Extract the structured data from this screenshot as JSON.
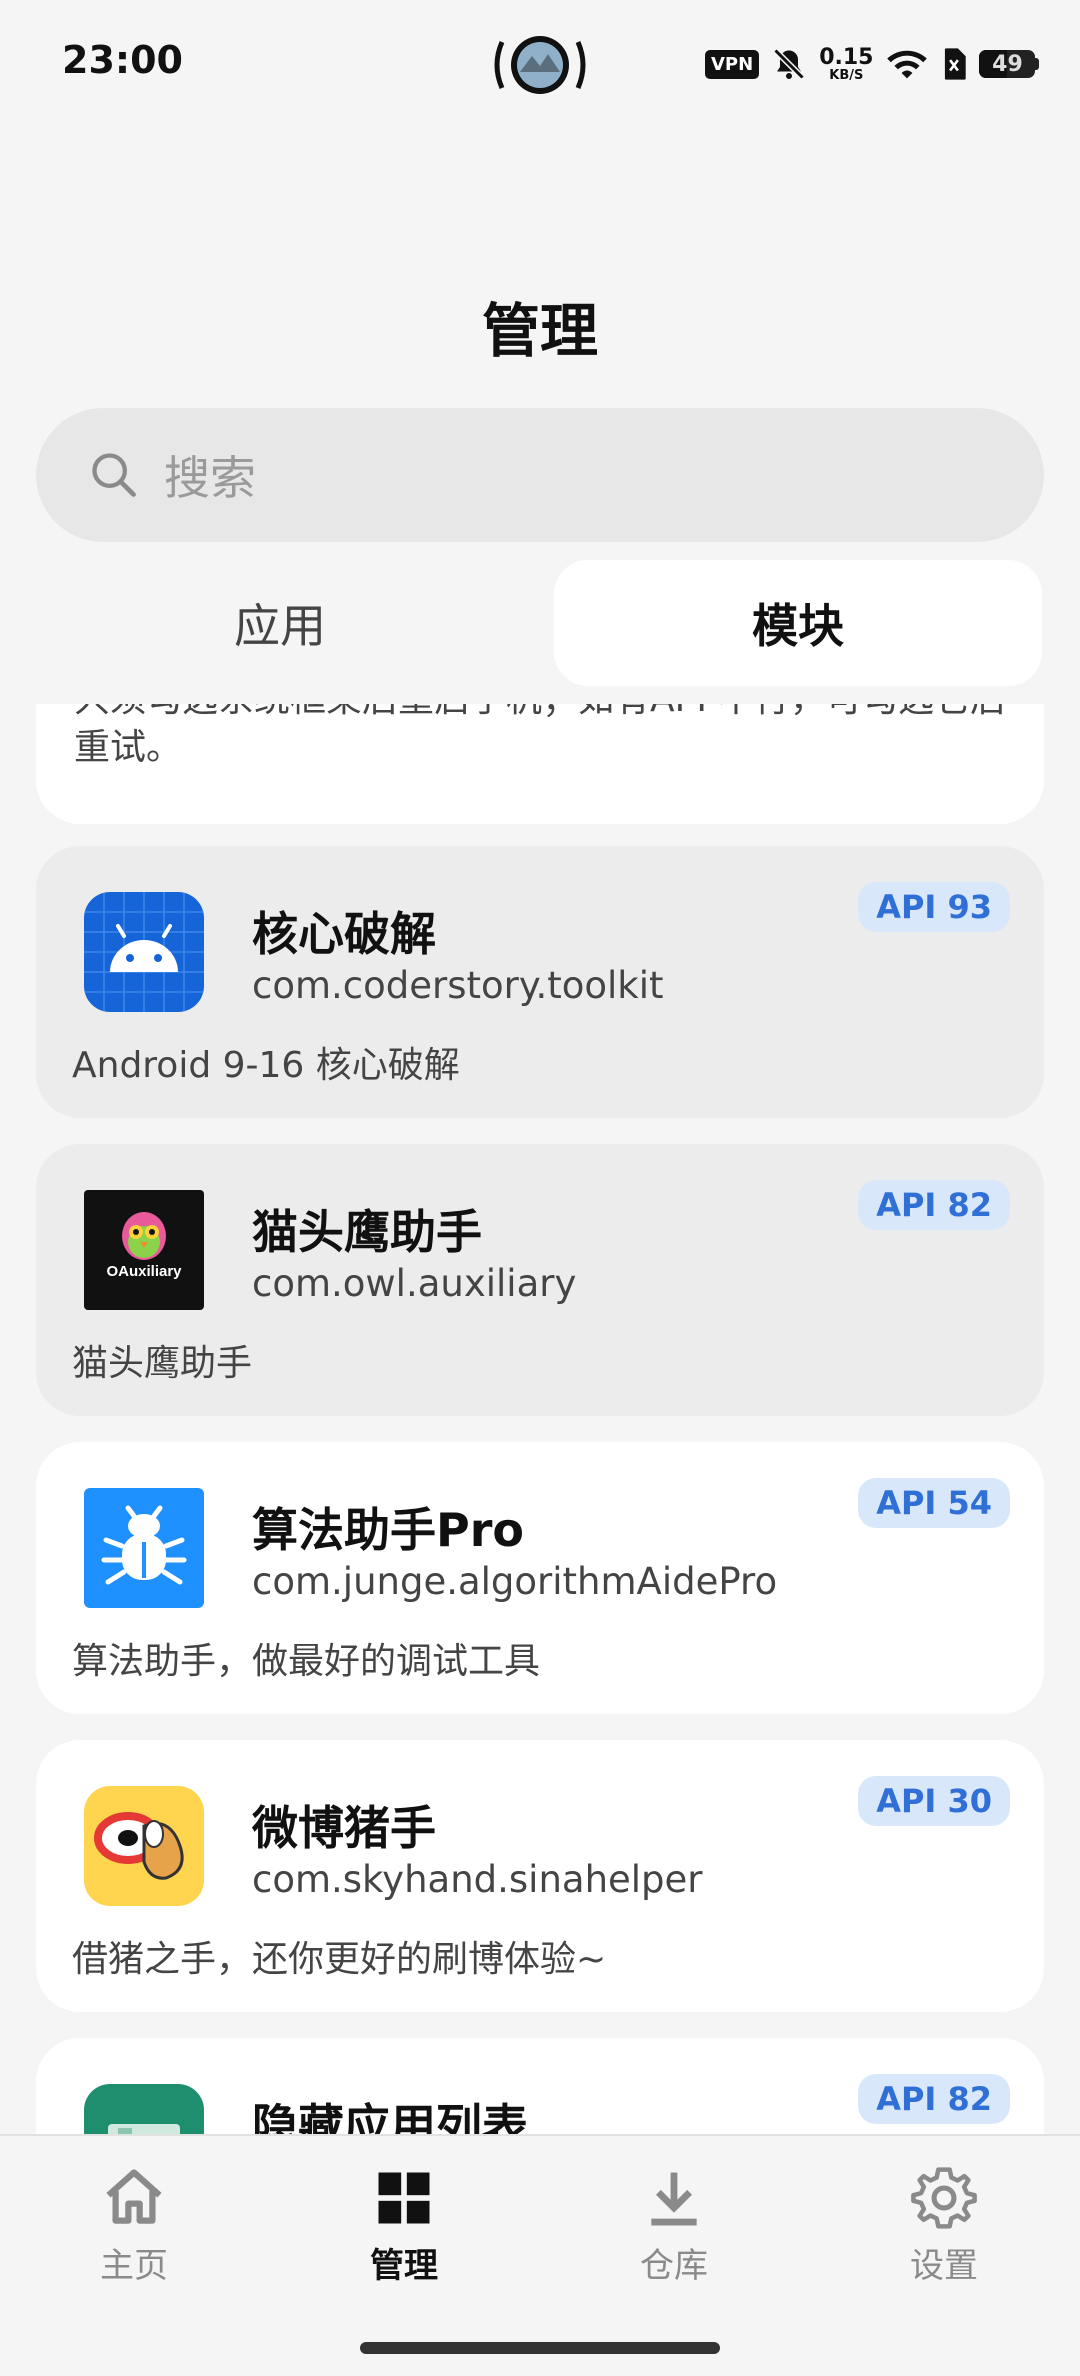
{
  "status_bar": {
    "time": "23:00",
    "vpn": "VPN",
    "net_speed_value": "0.15",
    "net_speed_unit": "KB/S",
    "battery": "49"
  },
  "header": {
    "title": "管理"
  },
  "search": {
    "placeholder": "搜索"
  },
  "tabs": [
    {
      "label": "应用",
      "active": false
    },
    {
      "label": "模块",
      "active": true
    }
  ],
  "note_card": {
    "text": "只须勾选系统框架后重启手机；如有APP不行，可勾选它后重试。"
  },
  "modules": [
    {
      "name": "核心破解",
      "package": "com.coderstory.toolkit",
      "description": "Android 9-16 核心破解",
      "api": "API 93",
      "icon": "android-icon",
      "icon_color": "#1565d8"
    },
    {
      "name": "猫头鹰助手",
      "package": "com.owl.auxiliary",
      "description": "猫头鹰助手",
      "api": "API 82",
      "icon": "owl-logo-icon",
      "icon_label": "OAuxiliary",
      "icon_color": "#111111"
    },
    {
      "name": "算法助手Pro",
      "package": "com.junge.algorithmAidePro",
      "description": "算法助手，做最好的调试工具",
      "api": "API 54",
      "icon": "bug-icon",
      "icon_color": "#1e90ff"
    },
    {
      "name": "微博猪手",
      "package": "com.skyhand.sinahelper",
      "description": "借猪之手，还你更好的刷博体验~",
      "api": "API 30",
      "icon": "weibo-pig-icon",
      "icon_color": "#ffd54f"
    },
    {
      "name": "隐藏应用列表",
      "package": "",
      "description": "",
      "api": "API 82",
      "icon": "hide-app-icon",
      "icon_color": "#1e8e6e"
    }
  ],
  "bottom_nav": [
    {
      "label": "主页",
      "icon": "home-icon",
      "active": false
    },
    {
      "label": "管理",
      "icon": "grid-icon",
      "active": true
    },
    {
      "label": "仓库",
      "icon": "download-icon",
      "active": false
    },
    {
      "label": "设置",
      "icon": "gear-icon",
      "active": false
    }
  ]
}
